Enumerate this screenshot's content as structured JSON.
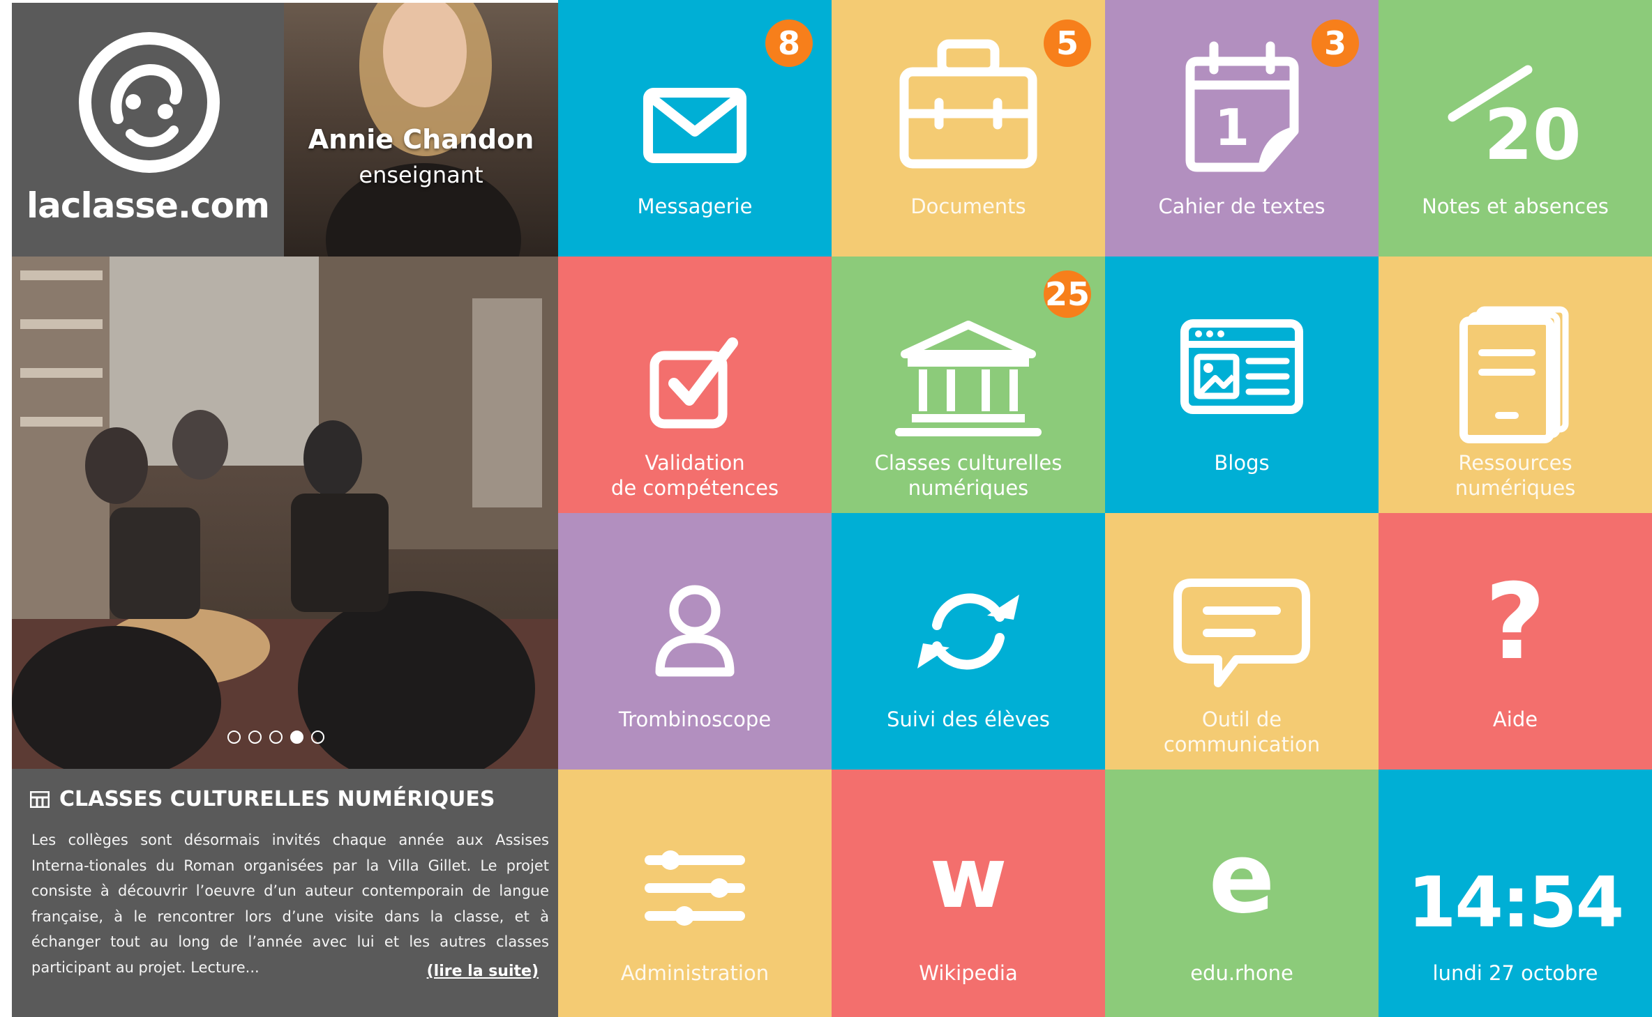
{
  "brand": {
    "name": "laclasse.com"
  },
  "profile": {
    "name": "Annie Chandon",
    "role": "enseignant"
  },
  "carousel": {
    "dot_count": 5,
    "active_index": 3
  },
  "news": {
    "title": "CLASSES CULTURELLES NUMÉRIQUES",
    "body": "Les collèges sont désormais invités chaque année aux Assises Interna-tionales du Roman organisées par la Villa Gillet. Le projet consiste à découvrir l’oeuvre d’un auteur contemporain de langue française, à le rencontrer lors d’une visite dans la classe, et à échanger tout au long de l’année avec lui et les autres classes participant au projet. Lecture...",
    "read_more": "(lire la suite)"
  },
  "tiles": {
    "messagerie": {
      "label": "Messagerie",
      "badge": "8"
    },
    "documents": {
      "label": "Documents",
      "badge": "5"
    },
    "cahier": {
      "label": "Cahier de textes",
      "badge": "3",
      "icon_day": "1"
    },
    "notes": {
      "label": "Notes et absences",
      "icon_text": "20"
    },
    "validation": {
      "label_line1": "Validation",
      "label_line2": "de compétences"
    },
    "classes": {
      "label_line1": "Classes culturelles",
      "label_line2": "numériques",
      "badge": "25"
    },
    "blogs": {
      "label": "Blogs"
    },
    "ressources": {
      "label_line1": "Ressources",
      "label_line2": "numériques"
    },
    "trombinoscope": {
      "label": "Trombinoscope"
    },
    "suivi": {
      "label": "Suivi des élèves"
    },
    "outil": {
      "label_line1": "Outil de",
      "label_line2": "communication"
    },
    "aide": {
      "label": "Aide",
      "icon_text": "?"
    },
    "administration": {
      "label": "Administration"
    },
    "wikipedia": {
      "label": "Wikipedia",
      "icon_text": "w"
    },
    "edurhone": {
      "label": "edu.rhone",
      "icon_text": "e"
    },
    "clock": {
      "time": "14:54",
      "date": "lundi 27 octobre"
    }
  },
  "icons": {
    "messagerie": "envelope-icon",
    "documents": "briefcase-icon",
    "cahier": "calendar-icon",
    "notes": "grade-icon",
    "validation": "checkbox-icon",
    "classes": "museum-icon",
    "blogs": "browser-window-icon",
    "ressources": "book-stack-icon",
    "trombinoscope": "person-icon",
    "suivi": "refresh-icon",
    "outil": "speech-bubble-icon",
    "aide": "question-mark-icon",
    "administration": "sliders-icon",
    "wikipedia": "wikipedia-w-icon",
    "edurhone": "letter-e-icon",
    "news": "grid-icon"
  },
  "colors": {
    "blue": "#00afd5",
    "yellow": "#f4cb73",
    "purple": "#b28fbf",
    "green": "#8ccb7a",
    "red": "#f36f6d",
    "badge": "#f77f1b",
    "panel_gray": "#5a5a5a"
  }
}
